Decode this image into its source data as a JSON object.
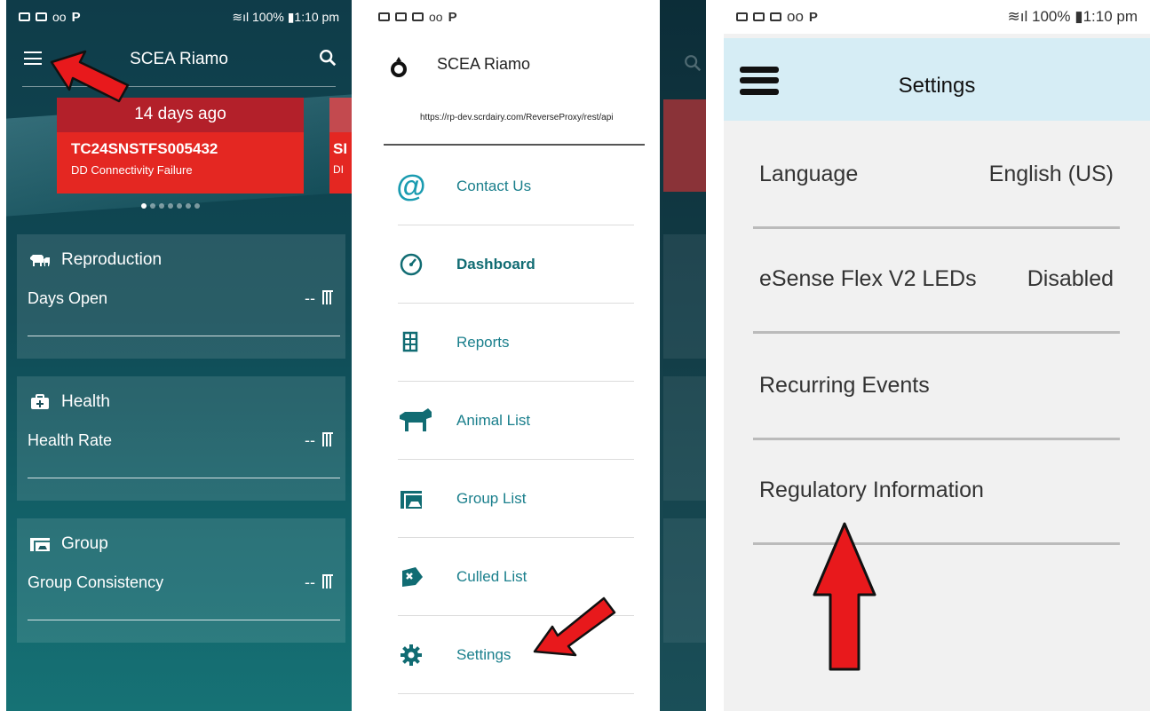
{
  "status": {
    "battery_pct": "100%",
    "time": "1:10 pm"
  },
  "home": {
    "title": "SCEA Riamo",
    "alert": {
      "age": "14 days ago",
      "id": "TC24SNSTFS005432",
      "message": "DD Connectivity Failure"
    },
    "alert_peek": {
      "id": "SI",
      "message": "DI"
    },
    "cards": [
      {
        "title": "Reproduction",
        "icon": "cow-calf-icon",
        "metric": "Days Open",
        "value": "--"
      },
      {
        "title": "Health",
        "icon": "medical-kit-icon",
        "metric": "Health Rate",
        "value": "--"
      },
      {
        "title": "Group",
        "icon": "group-pen-icon",
        "metric": "Group Consistency",
        "value": "--"
      }
    ]
  },
  "drawer": {
    "title": "SCEA Riamo",
    "url": "https://rp-dev.scrdairy.com/ReverseProxy/rest/api",
    "items": [
      {
        "label": "Contact Us",
        "icon": "at-sign-icon"
      },
      {
        "label": "Dashboard",
        "icon": "dashboard-gauge-icon"
      },
      {
        "label": "Reports",
        "icon": "reports-icon"
      },
      {
        "label": "Animal List",
        "icon": "cow-icon"
      },
      {
        "label": "Group List",
        "icon": "group-pen-icon"
      },
      {
        "label": "Culled List",
        "icon": "culled-icon"
      },
      {
        "label": "Settings",
        "icon": "gear-icon"
      }
    ]
  },
  "settings": {
    "title": "Settings",
    "items": [
      {
        "label": "Language",
        "value": "English (US)"
      },
      {
        "label": "eSense Flex V2 LEDs",
        "value": "Disabled"
      },
      {
        "label": "Recurring Events",
        "value": ""
      },
      {
        "label": "Regulatory Information",
        "value": ""
      }
    ]
  },
  "colors": {
    "alert_red": "#e42722",
    "alert_dark_red": "#b3202a",
    "teal": "#1a7f8c",
    "home_bg": "#0f3c49",
    "settings_header": "#d6edf5",
    "annotation_arrow": "#e8191c"
  }
}
